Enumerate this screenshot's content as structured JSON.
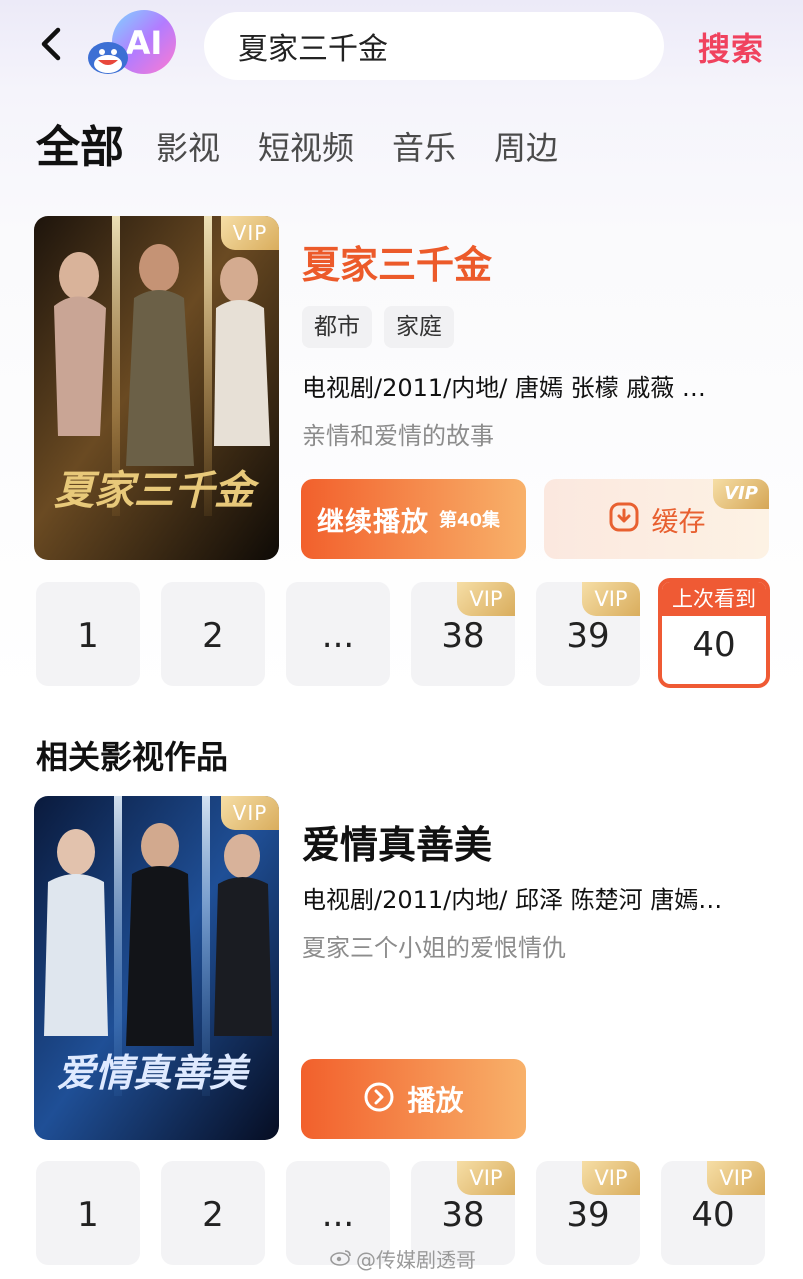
{
  "header": {
    "search_value": "夏家三千金",
    "search_button": "搜索",
    "logo_text": "AI"
  },
  "tabs": [
    {
      "label": "全部",
      "active": true
    },
    {
      "label": "影视",
      "active": false
    },
    {
      "label": "短视频",
      "active": false
    },
    {
      "label": "音乐",
      "active": false
    },
    {
      "label": "周边",
      "active": false
    }
  ],
  "main_result": {
    "title": "夏家三千金",
    "poster_title": "夏家三千金",
    "vip_badge": "VIP",
    "tags": [
      "都市",
      "家庭"
    ],
    "meta": "电视剧/2011/内地/ 唐嫣 张檬 戚薇 …",
    "description": "亲情和爱情的故事",
    "continue_button": "继续播放",
    "continue_episode": "第40集",
    "cache_button": "缓存",
    "cache_vip": "VIP",
    "episodes": [
      {
        "label": "1",
        "vip": false
      },
      {
        "label": "2",
        "vip": false
      },
      {
        "label": "...",
        "vip": false
      },
      {
        "label": "38",
        "vip": true
      },
      {
        "label": "39",
        "vip": true
      },
      {
        "label": "40",
        "vip": false,
        "last_watched": true
      }
    ],
    "last_watched_label": "上次看到"
  },
  "related_section_title": "相关影视作品",
  "related_result": {
    "title": "爱情真善美",
    "poster_title": "爱情真善美",
    "vip_badge": "VIP",
    "meta": "电视剧/2011/内地/ 邱泽 陈楚河 唐嫣…",
    "description": "夏家三个小姐的爱恨情仇",
    "play_button": "播放",
    "episodes": [
      {
        "label": "1",
        "vip": false
      },
      {
        "label": "2",
        "vip": false
      },
      {
        "label": "...",
        "vip": false
      },
      {
        "label": "38",
        "vip": true
      },
      {
        "label": "39",
        "vip": true
      },
      {
        "label": "40",
        "vip": true
      }
    ]
  },
  "vip_label": "VIP",
  "watermark": "@传媒剧透哥",
  "colors": {
    "accent_red": "#f0425e",
    "title_orange": "#ec5a2a",
    "button_gradient_start": "#f2602c",
    "button_gradient_end": "#f8b16a",
    "vip_gold": "#d9ad5d"
  }
}
